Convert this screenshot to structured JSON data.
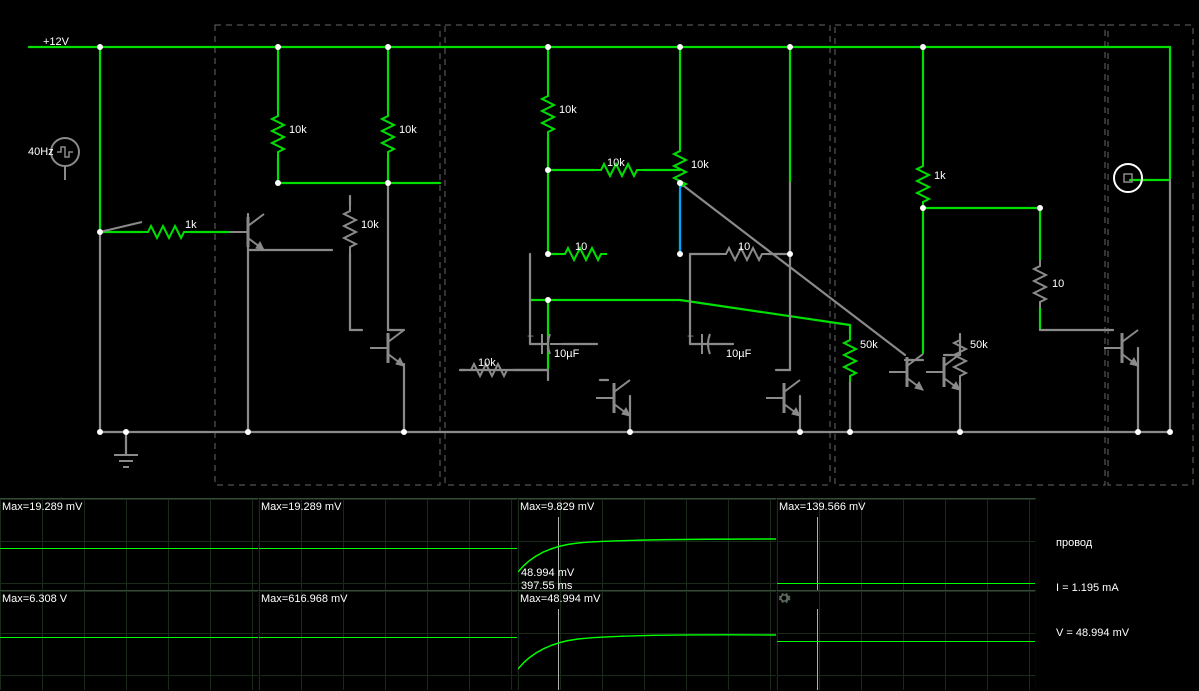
{
  "supply_label": "+12V",
  "source_label": "40Hz",
  "components": {
    "r1": "1k",
    "r2": "10k",
    "r3": "10k",
    "r4": "10k",
    "r5": "10k",
    "r6": "10k",
    "r7": "10k",
    "r8": "10",
    "r9": "10",
    "r10": "10k",
    "r11": "50k",
    "r12": "50k",
    "r13": "1k",
    "r14": "10",
    "c1": "10µF",
    "c2": "10µF"
  },
  "scopes": {
    "s1": {
      "max": "Max=19.289 mV"
    },
    "s2": {
      "max": "Max=19.289 mV"
    },
    "s3": {
      "max": "Max=9.829 mV"
    },
    "s4": {
      "max": "Max=139.566 mV"
    },
    "s5": {
      "max": "Max=6.308 V"
    },
    "s6": {
      "max": "Max=616.968 mV"
    },
    "s7": {
      "max": "Max=48.994 mV",
      "tooltip": "48.994 mV\n397.55 ms"
    },
    "s8": {
      "max": ""
    }
  },
  "info_panel": {
    "name": "провод",
    "i": "I = 1.195 mA",
    "v": "V = 48.994 mV"
  }
}
